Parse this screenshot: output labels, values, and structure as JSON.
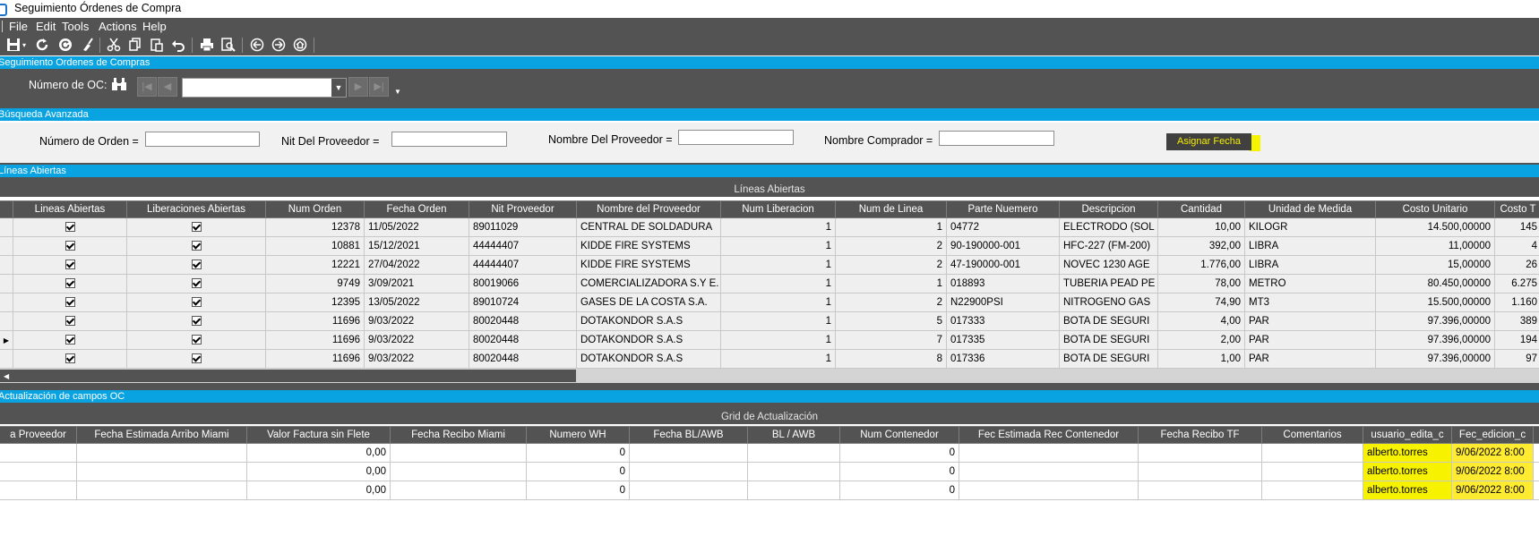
{
  "window": {
    "title": "Seguimiento Órdenes de Compra"
  },
  "menu": [
    "File",
    "Edit",
    "Tools",
    "Actions",
    "Help"
  ],
  "toolbar_icons": [
    "save-icon",
    "dropdown-icon",
    "refresh-icon",
    "refresh-alt-icon",
    "clear-icon",
    "cut-icon",
    "copy-icon",
    "paste-icon",
    "undo-icon",
    "print-icon",
    "print-preview-icon",
    "back-icon",
    "forward-icon",
    "home-icon"
  ],
  "sections": {
    "seguimiento": "Seguimiento Ordenes de Compras",
    "busqueda": "Búsqueda Avanzada",
    "lineas": "Líneas Abiertas",
    "actualizacion": "Actualización de campos OC"
  },
  "oc": {
    "label": "Número de OC:",
    "value": ""
  },
  "search": {
    "numero_orden_label": "Número de Orden =",
    "nit_label": "Nit Del Proveedor =",
    "nombre_proveedor_label": "Nombre Del Proveedor =",
    "nombre_comprador_label": "Nombre Comprador =",
    "assign_button": "Asignar Fecha"
  },
  "grid1": {
    "title": "Líneas Abiertas",
    "columns": [
      "Lineas Abiertas",
      "Liberaciones Abiertas",
      "Num Orden",
      "Fecha Orden",
      "Nit Proveedor",
      "Nombre del Proveedor",
      "Num Liberacion",
      "Num de Linea",
      "Parte Nuemero",
      "Descripcion",
      "Cantidad",
      "Unidad de Medida",
      "Costo Unitario",
      "Costo T"
    ],
    "rows": [
      [
        "12378",
        "11/05/2022",
        "89011029",
        "CENTRAL DE SOLDADURA",
        "1",
        "1",
        "04772",
        "ELECTRODO (SOL",
        "10,00",
        "KILOGR",
        "14.500,00000",
        "145"
      ],
      [
        "10881",
        "15/12/2021",
        "44444407",
        "KIDDE FIRE SYSTEMS",
        "1",
        "2",
        "90-190000-001",
        "HFC-227 (FM-200)",
        "392,00",
        "LIBRA",
        "11,00000",
        "4"
      ],
      [
        "12221",
        "27/04/2022",
        "44444407",
        "KIDDE FIRE SYSTEMS",
        "1",
        "2",
        "47-190000-001",
        "NOVEC 1230 AGE",
        "1.776,00",
        "LIBRA",
        "15,00000",
        "26"
      ],
      [
        "9749",
        "3/09/2021",
        "80019066",
        "COMERCIALIZADORA S.Y E.",
        "1",
        "1",
        "018893",
        "TUBERIA PEAD PE",
        "78,00",
        "METRO",
        "80.450,00000",
        "6.275"
      ],
      [
        "12395",
        "13/05/2022",
        "89010724",
        "GASES DE LA COSTA S.A.",
        "1",
        "2",
        "N22900PSI",
        "NITROGENO GAS",
        "74,90",
        "MT3",
        "15.500,00000",
        "1.160"
      ],
      [
        "11696",
        "9/03/2022",
        "80020448",
        "DOTAKONDOR S.A.S",
        "1",
        "5",
        "017333",
        "BOTA DE SEGURI",
        "4,00",
        "PAR",
        "97.396,00000",
        "389"
      ],
      [
        "11696",
        "9/03/2022",
        "80020448",
        "DOTAKONDOR S.A.S",
        "1",
        "7",
        "017335",
        "BOTA DE SEGURI",
        "2,00",
        "PAR",
        "97.396,00000",
        "194"
      ],
      [
        "11696",
        "9/03/2022",
        "80020448",
        "DOTAKONDOR S.A.S",
        "1",
        "8",
        "017336",
        "BOTA DE SEGURI",
        "1,00",
        "PAR",
        "97.396,00000",
        "97"
      ]
    ]
  },
  "grid2": {
    "title": "Grid de Actualización",
    "columns": [
      "a Proveedor",
      "Fecha Estimada Arribo Miami",
      "Valor Factura sin Flete",
      "Fecha Recibo Miami",
      "Numero WH",
      "Fecha BL/AWB",
      "BL / AWB",
      "Num Contenedor",
      "Fec Estimada Rec Contenedor",
      "Fecha Recibo TF",
      "Comentarios",
      "usuario_edita_c",
      "Fec_edicion_c"
    ],
    "rows": [
      [
        "",
        "",
        "0,00",
        "",
        "0",
        "",
        "",
        "0",
        "",
        "",
        "",
        "alberto.torres",
        "9/06/2022 8:00"
      ],
      [
        "",
        "",
        "0,00",
        "",
        "0",
        "",
        "",
        "0",
        "",
        "",
        "",
        "alberto.torres",
        "9/06/2022 8:00"
      ],
      [
        "",
        "",
        "0,00",
        "",
        "0",
        "",
        "",
        "0",
        "",
        "",
        "",
        "alberto.torres",
        "9/06/2022 8:00"
      ]
    ]
  }
}
